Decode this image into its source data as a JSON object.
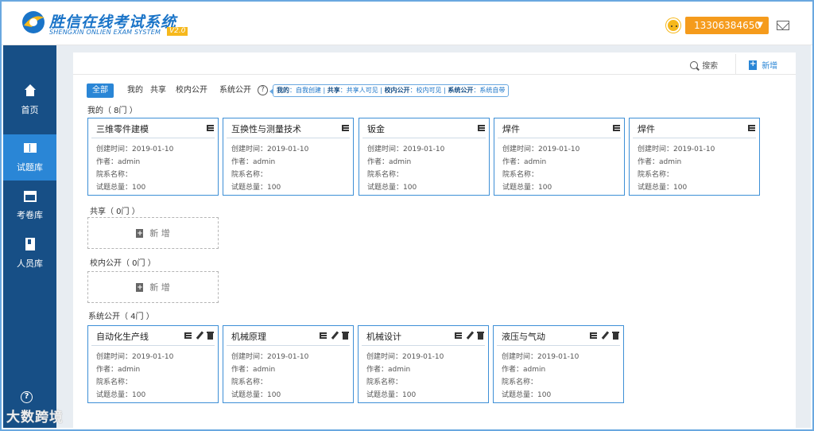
{
  "header": {
    "brand_title": "胜信在线考试系统",
    "brand_subtitle": "SHENGXIN ONLIEN EXAM SYSTEM",
    "version": "V2.0",
    "user_phone": "13306384650",
    "user_caret": "▼"
  },
  "sidebar": {
    "items": [
      {
        "label": "首页",
        "icon": "home-icon"
      },
      {
        "label": "试题库",
        "icon": "book-icon"
      },
      {
        "label": "考卷库",
        "icon": "calendar-icon"
      },
      {
        "label": "人员库",
        "icon": "document-icon"
      }
    ],
    "help_label": "?"
  },
  "toolbar": {
    "search_label": "搜索",
    "add_label": "新增"
  },
  "filters": {
    "all": "全部",
    "mine": "我的",
    "shared": "共享",
    "school": "校内公开",
    "system": "系统公开",
    "help": "?",
    "legend": {
      "k1": "我的",
      "v1": "：自我创建 | ",
      "k2": "共享",
      "v2": "：共享人可见 | ",
      "k3": "校内公开",
      "v3": "：校内可见 | ",
      "k4": "系统公开",
      "v4": "：系统自带"
    }
  },
  "sections": {
    "mine": "我的（ 8门 ）",
    "shared": "共享（ 0门 ）",
    "school": "校内公开（ 0门 ）",
    "system": "系统公开（ 4门 ）"
  },
  "add_card_label": "新 增",
  "field_labels": {
    "created": "创建时间：",
    "author": "作者：",
    "dept": "院系名称：",
    "total": "试题总量："
  },
  "my_cards": [
    {
      "title": "三维零件建模",
      "created": "2019-01-10",
      "author": "admin",
      "dept": "",
      "total": "100"
    },
    {
      "title": "互换性与测量技术",
      "created": "2019-01-10",
      "author": "admin",
      "dept": "",
      "total": "100"
    },
    {
      "title": "钣金",
      "created": "2019-01-10",
      "author": "admin",
      "dept": "",
      "total": "100"
    },
    {
      "title": "焊件",
      "created": "2019-01-10",
      "author": "admin",
      "dept": "",
      "total": "100"
    },
    {
      "title": "焊件",
      "created": "2019-01-10",
      "author": "admin",
      "dept": "",
      "total": "100"
    }
  ],
  "system_cards": [
    {
      "title": "自动化生产线",
      "created": "2019-01-10",
      "author": "admin",
      "dept": "",
      "total": "100"
    },
    {
      "title": "机械原理",
      "created": "2019-01-10",
      "author": "admin",
      "dept": "",
      "total": "100"
    },
    {
      "title": "机械设计",
      "created": "2019-01-10",
      "author": "admin",
      "dept": "",
      "total": "100"
    },
    {
      "title": "液压与气动",
      "created": "2019-01-10",
      "author": "admin",
      "dept": "",
      "total": "100"
    }
  ],
  "watermark": "大数跨境"
}
